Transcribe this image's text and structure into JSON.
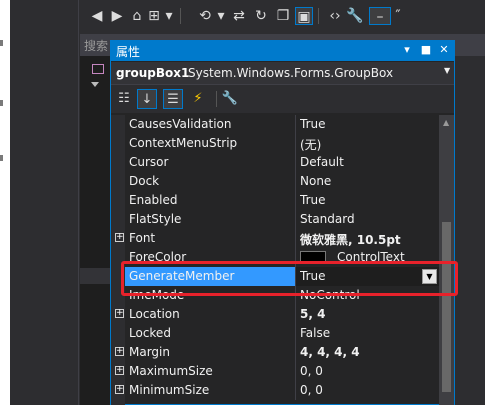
{
  "search_placeholder": "搜索",
  "toolbar": {
    "icons": [
      "back-circle-icon",
      "forward-circle-icon",
      "home-icon",
      "dropdown-icon",
      "history-icon",
      "sync-icon",
      "refresh-icon",
      "copy-icon",
      "show-all-files-icon",
      "code-icon",
      "wrench-icon",
      "pin-icon"
    ]
  },
  "panel": {
    "title": "属性",
    "pin_glyph": "▾",
    "dock_glyph": "■",
    "close_glyph": "✕"
  },
  "object_selector": {
    "name": "groupBox1",
    "type": "System.Windows.Forms.GroupBox"
  },
  "properties": [
    {
      "name": "CausesValidation",
      "value": "True",
      "expandable": false
    },
    {
      "name": "ContextMenuStrip",
      "value": "(无)",
      "expandable": false
    },
    {
      "name": "Cursor",
      "value": "Default",
      "expandable": false
    },
    {
      "name": "Dock",
      "value": "None",
      "expandable": false
    },
    {
      "name": "Enabled",
      "value": "True",
      "expandable": false
    },
    {
      "name": "FlatStyle",
      "value": "Standard",
      "expandable": false
    },
    {
      "name": "Font",
      "value": "微软雅黑, 10.5pt",
      "expandable": true,
      "bold": true
    },
    {
      "name": "ForeColor",
      "value": "ControlText",
      "expandable": false,
      "swatch": "#000000"
    },
    {
      "name": "GenerateMember",
      "value": "True",
      "expandable": false,
      "selected": true
    },
    {
      "name": "ImeMode",
      "value": "NoControl",
      "expandable": false
    },
    {
      "name": "Location",
      "value": "5, 4",
      "expandable": true,
      "bold": true
    },
    {
      "name": "Locked",
      "value": "False",
      "expandable": false
    },
    {
      "name": "Margin",
      "value": "4, 4, 4, 4",
      "expandable": true,
      "bold": true
    },
    {
      "name": "MaximumSize",
      "value": "0, 0",
      "expandable": true
    },
    {
      "name": "MinimumSize",
      "value": "0, 0",
      "expandable": true
    }
  ],
  "colors": {
    "accent": "#007acc",
    "selection": "#3399ff",
    "highlight_box": "#e8222b"
  }
}
